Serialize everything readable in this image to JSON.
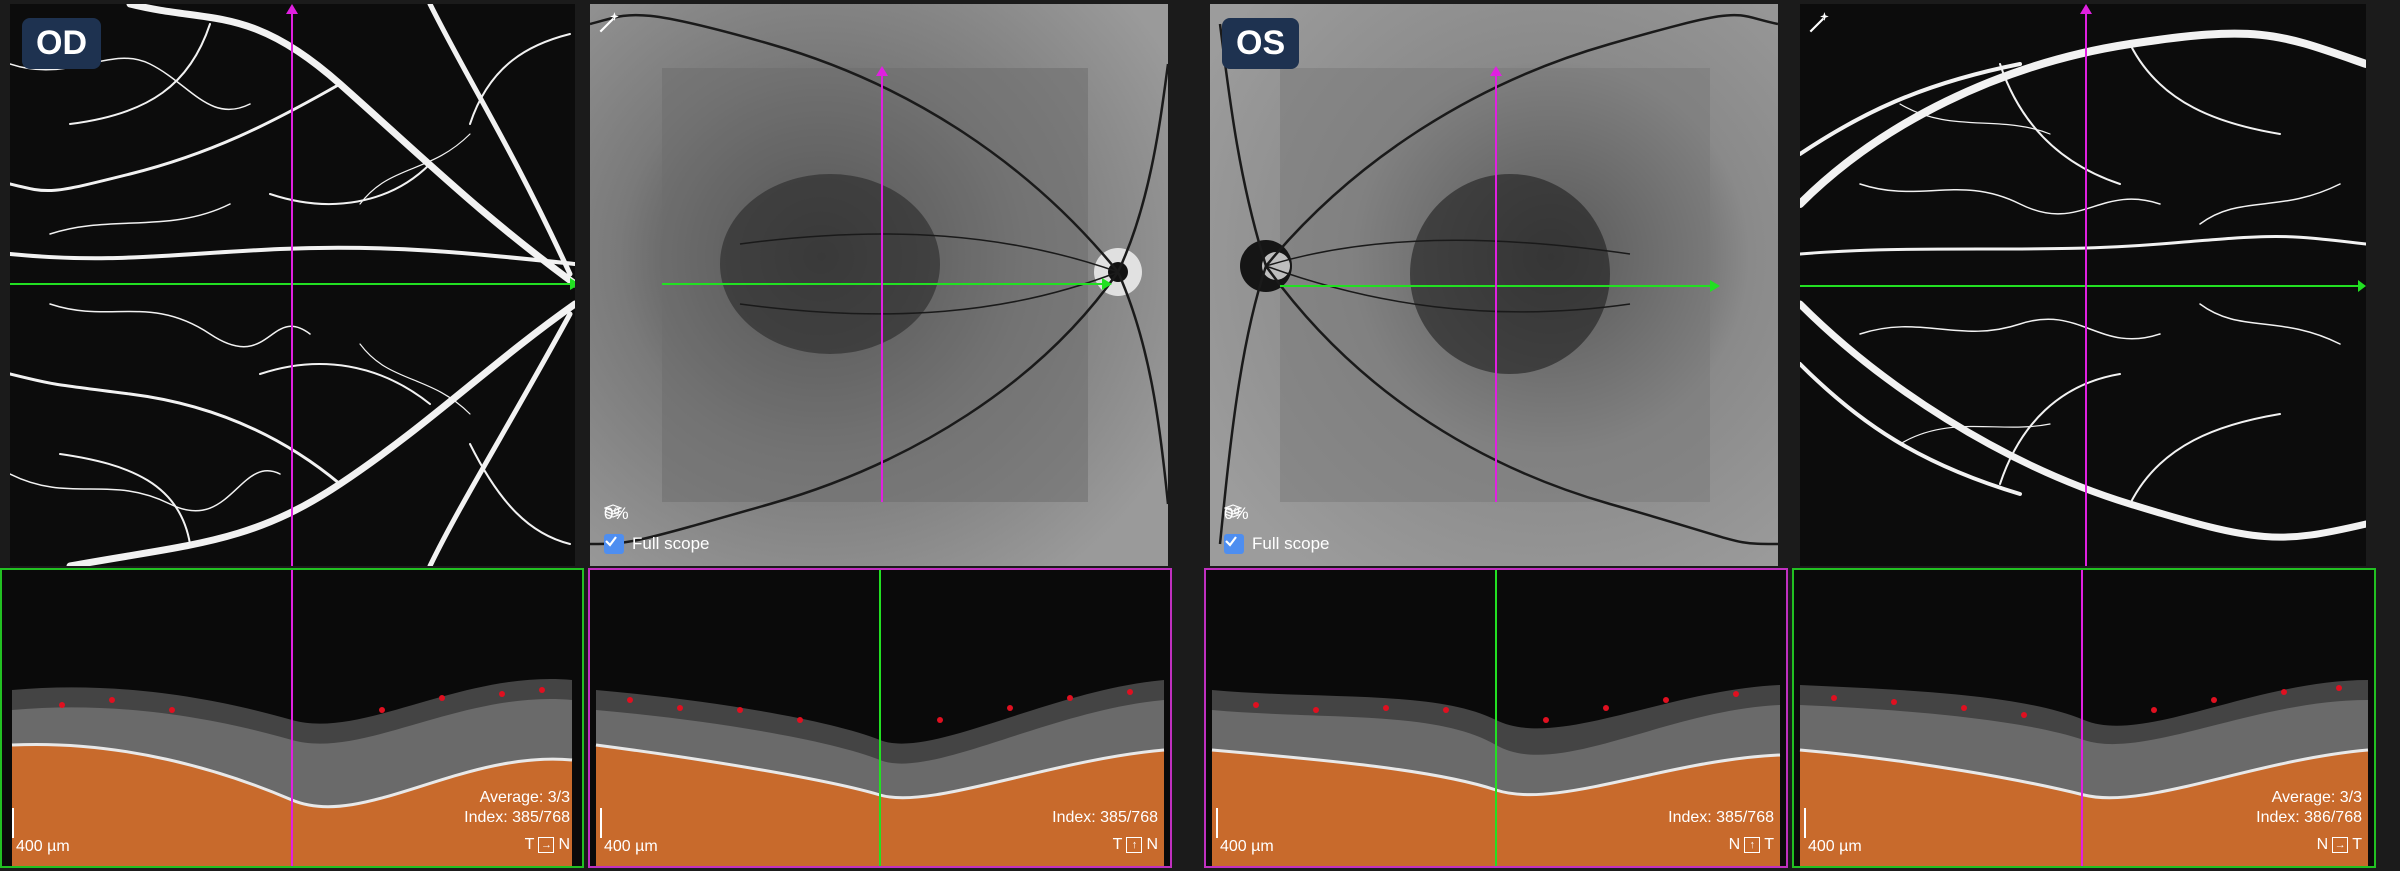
{
  "colors": {
    "green": "#22e022",
    "magenta": "#e020e0",
    "accent": "#4e8ef0",
    "badge": "#1e3250"
  },
  "right_eye": {
    "label": "OD",
    "fundus": {
      "percent": "0%",
      "full_scope": "Full scope"
    },
    "bscan_green": {
      "average": "Average: 3/3",
      "index": "Index: 385/768",
      "orient_a": "T",
      "orient_arrow": "→",
      "orient_b": "N",
      "scale": "400 µm"
    },
    "bscan_magenta": {
      "index": "Index: 385/768",
      "orient_a": "T",
      "orient_arrow": "↑",
      "orient_b": "N",
      "scale": "400 µm"
    }
  },
  "left_eye": {
    "label": "OS",
    "fundus": {
      "percent": "0%",
      "full_scope": "Full scope"
    },
    "bscan_green": {
      "index": "Index: 385/768",
      "orient_a": "N",
      "orient_arrow": "↑",
      "orient_b": "T",
      "scale": "400 µm"
    },
    "bscan_magenta": {
      "average": "Average: 3/3",
      "index": "Index: 386/768",
      "orient_a": "N",
      "orient_arrow": "→",
      "orient_b": "T",
      "scale": "400 µm"
    }
  },
  "icons": [
    "magic-wand-icon",
    "layers-icon",
    "checkbox-icon",
    "arrow-right-icon",
    "arrow-up-icon"
  ]
}
